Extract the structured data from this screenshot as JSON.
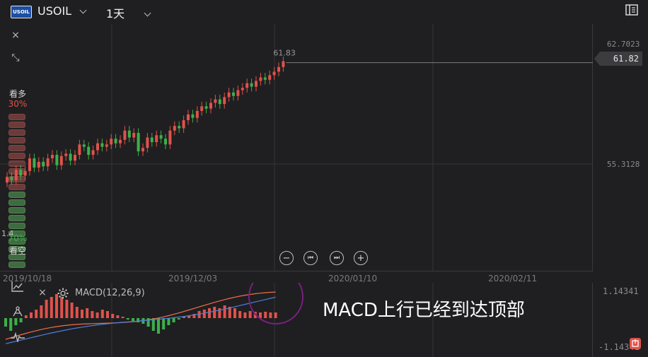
{
  "header": {
    "logo_text": "USOIL",
    "symbol": "USOIL",
    "timeframe": "1天"
  },
  "left_tools": {
    "close": "×",
    "collapse": "⤡"
  },
  "sentiment": {
    "bull_label": "看多",
    "bull_pct": "30%",
    "bear_pct": "70%",
    "bear_label": "看空",
    "bull_segments": 10,
    "bear_segments": 10,
    "bull_color": "#e0524a",
    "bear_color": "#3cb04a",
    "side_value": "1.4"
  },
  "price_scale": {
    "top": "62.7023",
    "mid": "55.3128",
    "last_price": "61.82"
  },
  "chart": {
    "last_label": "61.83",
    "up_color": "#e0524a",
    "down_color": "#3cb04a"
  },
  "x_axis": {
    "labels": [
      "2019/10/18",
      "2019/12/03",
      "2020/01/10",
      "2020/02/11"
    ]
  },
  "nav_buttons": [
    "−",
    "⏮",
    "⏭",
    "+"
  ],
  "macd": {
    "title": "MACD(12,26,9)",
    "scale_top": "1.14341",
    "scale_bottom": "-1.14341",
    "dif_color": "#f26d4a",
    "dea_color": "#4a7fe0",
    "circle_color": "#7b1f82"
  },
  "annotation": "MACD上行已经到达顶部"
}
